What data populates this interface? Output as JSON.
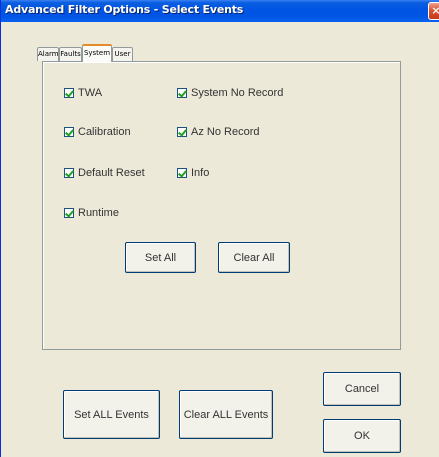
{
  "window": {
    "title": "Advanced Filter Options - Select Events",
    "close_glyph": "×"
  },
  "tabs": [
    {
      "label": "Alarm",
      "active": false
    },
    {
      "label": "Faults",
      "active": false
    },
    {
      "label": "System",
      "active": true
    },
    {
      "label": "User",
      "active": false
    }
  ],
  "system_tab": {
    "checkboxes": [
      {
        "label": "TWA",
        "checked": true
      },
      {
        "label": "System No Record",
        "checked": true
      },
      {
        "label": "Calibration",
        "checked": true
      },
      {
        "label": "Az No Record",
        "checked": true
      },
      {
        "label": "Default Reset",
        "checked": true
      },
      {
        "label": "Info",
        "checked": true
      },
      {
        "label": "Runtime",
        "checked": true
      }
    ],
    "set_all_label": "Set All",
    "clear_all_label": "Clear All"
  },
  "footer": {
    "set_all_events_label": "Set ALL Events",
    "clear_all_events_label": "Clear ALL Events",
    "cancel_label": "Cancel",
    "ok_label": "OK"
  }
}
